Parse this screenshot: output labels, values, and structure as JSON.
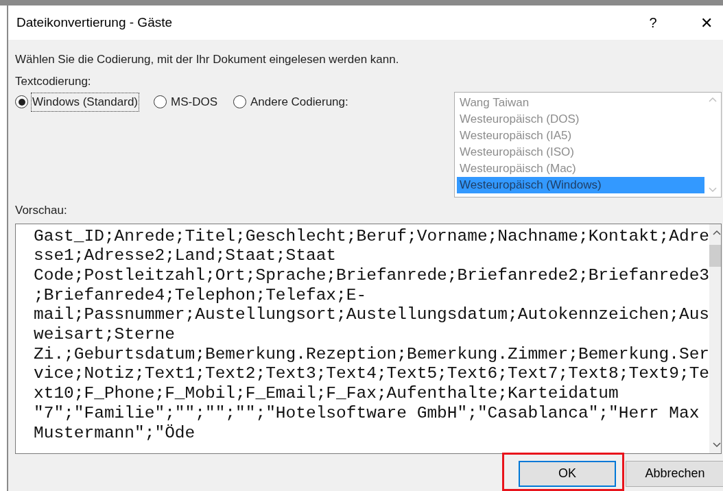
{
  "window": {
    "title": "Dateikonvertierung - Gäste",
    "help": "?",
    "close": "✕"
  },
  "instruction": "Wählen Sie die Codierung, mit der Ihr Dokument eingelesen werden kann.",
  "encoding_label": "Textcodierung:",
  "radios": [
    {
      "label": "Windows (Standard)",
      "selected": true,
      "focused": true
    },
    {
      "label": "MS-DOS",
      "selected": false,
      "focused": false
    },
    {
      "label": "Andere Codierung:",
      "selected": false,
      "focused": false
    }
  ],
  "encoding_list": {
    "disabled": true,
    "items": [
      {
        "label": "Wang Taiwan",
        "selected": false
      },
      {
        "label": "Westeuropäisch (DOS)",
        "selected": false
      },
      {
        "label": "Westeuropäisch (IA5)",
        "selected": false
      },
      {
        "label": "Westeuropäisch (ISO)",
        "selected": false
      },
      {
        "label": "Westeuropäisch (Mac)",
        "selected": false
      },
      {
        "label": "Westeuropäisch (Windows)",
        "selected": true
      }
    ]
  },
  "preview_label": "Vorschau:",
  "preview_lines": [
    "Gast_ID;Anrede;Titel;Geschlecht;Beruf;Vorname;Nachname;Kontakt;Adre",
    "sse1;Adresse2;Land;Staat;Staat",
    "Code;Postleitzahl;Ort;Sprache;Briefanrede;Briefanrede2;Briefanrede3",
    ";Briefanrede4;Telephon;Telefax;E-",
    "mail;Passnummer;Austellungsort;Austellungsdatum;Autokennzeichen;Aus",
    "weisart;Sterne",
    "Zi.;Geburtsdatum;Bemerkung.Rezeption;Bemerkung.Zimmer;Bemerkung.Ser",
    "vice;Notiz;Text1;Text2;Text3;Text4;Text5;Text6;Text7;Text8;Text9;Te",
    "xt10;F_Phone;F_Mobil;F_Email;F_Fax;Aufenthalte;Karteidatum",
    "\"7\";\"Familie\";\"\";\"\";\"\";\"Hotelsoftware GmbH\";\"Casablanca\";\"Herr Max",
    "Mustermann\";\"Öde"
  ],
  "buttons": [
    {
      "label": "OK",
      "kind": "default"
    },
    {
      "label": "Abbrechen",
      "kind": "normal"
    }
  ],
  "highlight_frame": true
}
